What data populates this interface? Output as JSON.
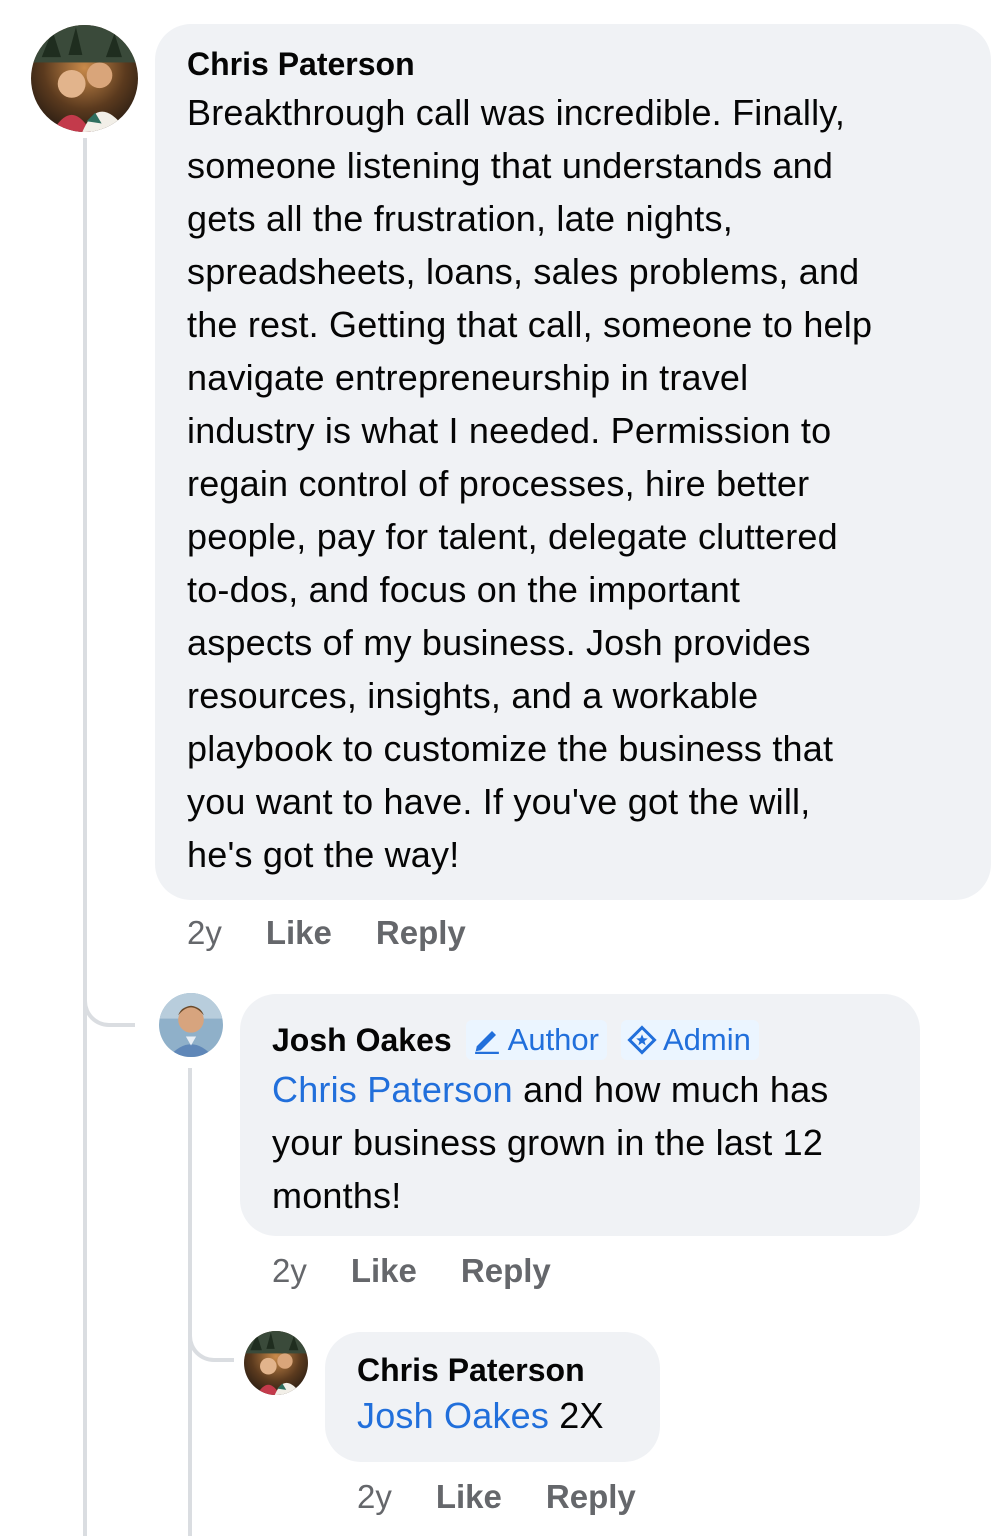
{
  "comments": [
    {
      "author": "Chris Paterson",
      "text": "Breakthrough call was incredible. Finally,\nsomeone listening that understands and\ngets all the frustration, late nights,\nspreadsheets, loans, sales problems, and\nthe rest. Getting that call, someone to help\nnavigate entrepreneurship in travel\nindustry is what I needed. Permission to\nregain control of processes, hire better\npeople, pay for talent, delegate cluttered\nto-dos, and focus on the important\naspects of my business. Josh provides\nresources, insights, and a workable\nplaybook to customize the business that\nyou want to have. If you've got the will,\nhe's got the way!",
      "time": "2y",
      "like_label": "Like",
      "reply_label": "Reply"
    },
    {
      "author": "Josh Oakes",
      "badges": {
        "author_label": "Author",
        "author_icon": "pencil-icon",
        "admin_label": "Admin",
        "admin_icon": "admin-star-icon"
      },
      "mention": "Chris Paterson",
      "text": " and how much has\nyour business grown in the last 12\nmonths!",
      "time": "2y",
      "like_label": "Like",
      "reply_label": "Reply"
    },
    {
      "author": "Chris Paterson",
      "mention": "Josh Oakes",
      "text": " 2X",
      "time": "2y",
      "like_label": "Like",
      "reply_label": "Reply"
    }
  ],
  "colors": {
    "bubble_bg": "#f0f2f5",
    "link_blue": "#216fdb",
    "meta_gray": "#65676b",
    "badge_bg": "#ebf5ff",
    "thread_line": "#dadde1"
  }
}
